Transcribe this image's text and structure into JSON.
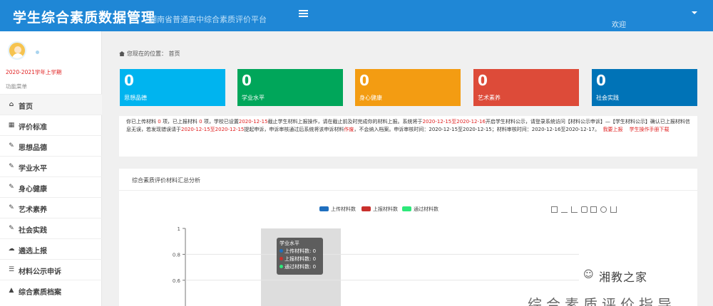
{
  "header": {
    "title": "学生综合素质数据管理",
    "subtitle": "湖南省普通高中综合素质评价平台",
    "user": "欢迎"
  },
  "sidebar": {
    "semester": "2020-2021学年上学期",
    "menu_title": "功能菜单",
    "items": [
      {
        "label": "首页",
        "icon": "home-icon"
      },
      {
        "label": "评价标准",
        "icon": "map-icon"
      },
      {
        "label": "思想品德",
        "icon": "edit-icon"
      },
      {
        "label": "学业水平",
        "icon": "edit-icon"
      },
      {
        "label": "身心健康",
        "icon": "edit-icon"
      },
      {
        "label": "艺术素养",
        "icon": "edit-icon"
      },
      {
        "label": "社会实践",
        "icon": "edit-icon"
      },
      {
        "label": "遴选上报",
        "icon": "cloud-upload-icon"
      },
      {
        "label": "材料公示申诉",
        "icon": "list-icon"
      },
      {
        "label": "综合素质档案",
        "icon": "graduation-cap-icon"
      }
    ]
  },
  "breadcrumb": {
    "prefix": "您现在的位置：",
    "current": "首页"
  },
  "stats": [
    {
      "value": "0",
      "label": "思想品德",
      "color": "#00b4ef"
    },
    {
      "value": "0",
      "label": "学业水平",
      "color": "#00a65a"
    },
    {
      "value": "0",
      "label": "身心健康",
      "color": "#f39c12"
    },
    {
      "value": "0",
      "label": "艺术素养",
      "color": "#dd4b39"
    },
    {
      "value": "0",
      "label": "社会实践",
      "color": "#0073b7"
    }
  ],
  "notice": {
    "t1": "你已上传材料",
    "n1": "0",
    "t2": "项，已上报材料",
    "n2": "0",
    "t3": "项，学校已设置",
    "d1": "2020-12-15",
    "t4": "截止学生材料上报操作，请在截止前及时完成你的材料上报。系统将于",
    "d2": "2020-12-15至2020-12-16",
    "t5": "开启学生材料公示，请登录系统访问【材料公示申诉】—【学生材料公示】确认已上报材料信息无误，若发现错误请于",
    "d3": "2020-12-15至2020-12-15",
    "t6": "提起申诉，申诉审核通过后系统将该申诉材料",
    "w1": "作废",
    "t7": "，不会纳入档案。申诉审核时间：2020-12-15至2020-12-15；材料审核时间：2020-12-16至2020-12-17。",
    "link1": "我要上报",
    "link2": "学生操作手册下载"
  },
  "chart_panel": {
    "title": "综合素质评价材料汇总分析",
    "legend": [
      {
        "name": "上传材料数",
        "color": "#1f6fbf"
      },
      {
        "name": "上报材料数",
        "color": "#c9302c"
      },
      {
        "name": "通过材料数",
        "color": "#2ee87a"
      }
    ],
    "toolbox": [
      "data-view-icon",
      "line-icon",
      "bar-icon",
      "stack-icon",
      "tiled-icon",
      "restore-icon",
      "save-image-icon"
    ]
  },
  "chart_data": {
    "type": "bar",
    "categories": [
      "学业水平"
    ],
    "series": [
      {
        "name": "上传材料数",
        "values": [
          0
        ]
      },
      {
        "name": "上报材料数",
        "values": [
          0
        ]
      },
      {
        "name": "通过材料数",
        "values": [
          0
        ]
      }
    ],
    "yticks": [
      "1",
      "0.8",
      "0.6"
    ],
    "ylim": [
      0,
      1
    ],
    "legend_position": "top-center"
  },
  "tooltip": {
    "title": "学业水平",
    "rows": [
      {
        "label": "上传材料数:",
        "value": "0",
        "color": "#1f6fbf"
      },
      {
        "label": "上报材料数:",
        "value": "0",
        "color": "#c9302c"
      },
      {
        "label": "通过材料数:",
        "value": "0",
        "color": "#2ee87a"
      }
    ]
  },
  "watermark": {
    "name": "湘教之家",
    "bottom": "综合素质评价指导"
  }
}
